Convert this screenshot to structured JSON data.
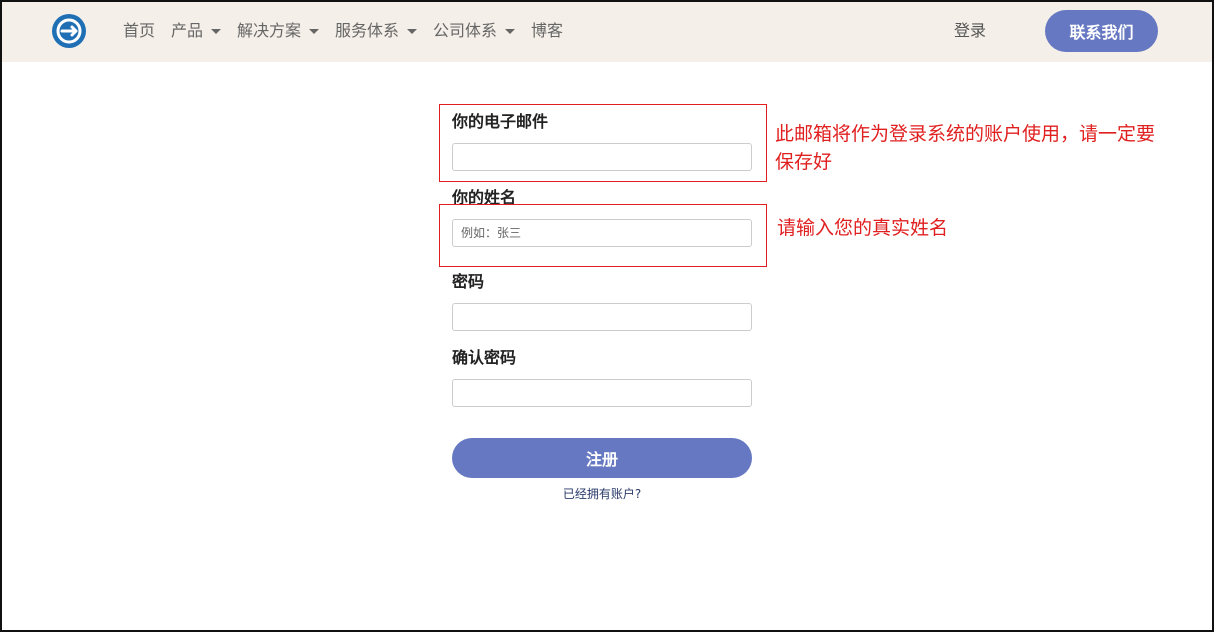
{
  "colors": {
    "navbar_bg": "#f4efe8",
    "primary_button": "#6678c2",
    "annotation": "#e02020",
    "logo": "#1f6fb5"
  },
  "navbar": {
    "logo_icon": "brand-logo-icon",
    "items": [
      {
        "label": "首页",
        "has_dropdown": false
      },
      {
        "label": "产品",
        "has_dropdown": true
      },
      {
        "label": "解决方案",
        "has_dropdown": true
      },
      {
        "label": "服务体系",
        "has_dropdown": true
      },
      {
        "label": "公司体系",
        "has_dropdown": true
      },
      {
        "label": "博客",
        "has_dropdown": false
      }
    ],
    "login_label": "登录",
    "contact_label": "联系我们"
  },
  "form": {
    "email_label": "你的电子邮件",
    "email_value": "",
    "name_label": "你的姓名",
    "name_placeholder": "例如：张三",
    "password_label": "密码",
    "password_value": "",
    "confirm_label": "确认密码",
    "confirm_value": "",
    "register_label": "注册",
    "have_account_label": "已经拥有账户?"
  },
  "annotations": {
    "email_note_line1": "此邮箱将作为登录系统的账户使用，请一定要",
    "email_note_line2": "保存好",
    "name_note": "请输入您的真实姓名"
  }
}
